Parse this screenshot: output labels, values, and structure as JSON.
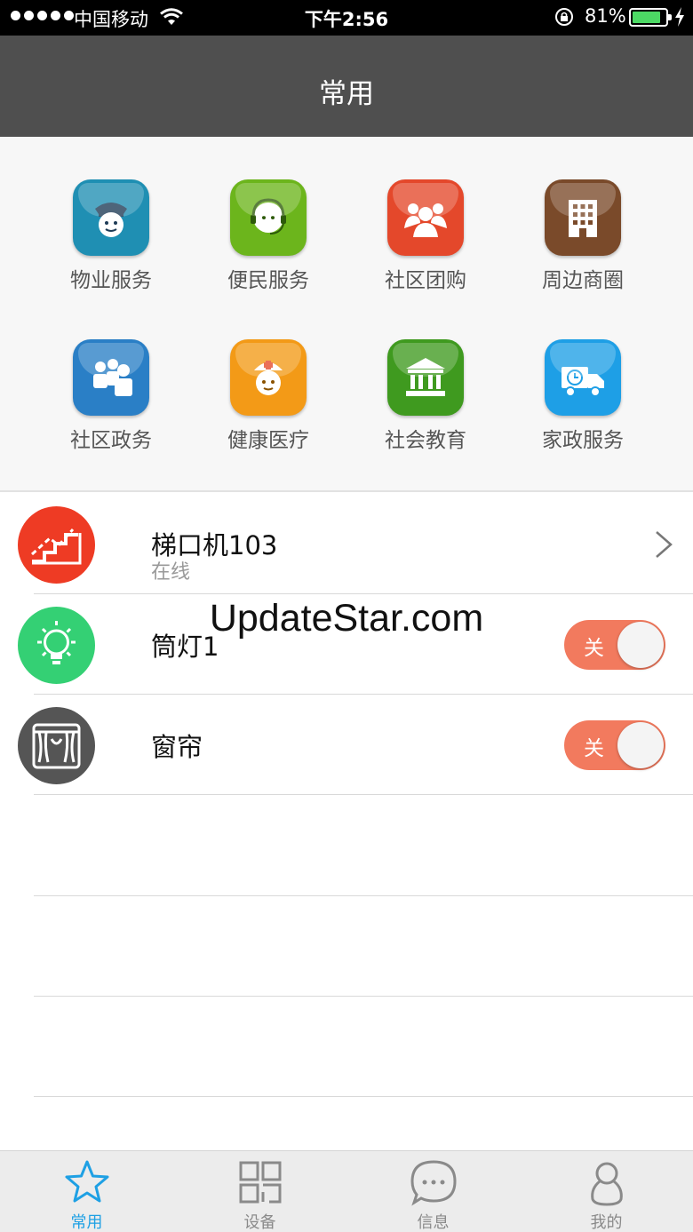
{
  "status_bar": {
    "carrier": "中国移动",
    "time": "下午2:56",
    "battery": "81%",
    "battery_level": 0.81
  },
  "nav": {
    "title": "常用"
  },
  "services": [
    {
      "label": "物业服务",
      "icon": "security-guard-icon",
      "color": "#1f8fb3"
    },
    {
      "label": "便民服务",
      "icon": "customer-service-icon",
      "color": "#6cb51c"
    },
    {
      "label": "社区团购",
      "icon": "group-people-icon",
      "color": "#e4482b"
    },
    {
      "label": "周边商圈",
      "icon": "building-icon",
      "color": "#7a4a2a"
    },
    {
      "label": "社区政务",
      "icon": "users-icon",
      "color": "#2a7fc6"
    },
    {
      "label": "健康医疗",
      "icon": "nurse-icon",
      "color": "#f39a17"
    },
    {
      "label": "社会教育",
      "icon": "institution-icon",
      "color": "#3f9a1f"
    },
    {
      "label": "家政服务",
      "icon": "moving-truck-icon",
      "color": "#1e9fe6"
    }
  ],
  "devices": [
    {
      "name": "梯口机103",
      "status": "在线",
      "icon": "stairs-icon",
      "color": "#ee3b24"
    },
    {
      "name": "筒灯1",
      "toggle": "关",
      "icon": "light-bulb-icon",
      "color": "#34d074"
    },
    {
      "name": "窗帘",
      "toggle": "关",
      "icon": "curtain-icon",
      "color": "#555555"
    }
  ],
  "watermark": "UpdateStar.com",
  "tabs": [
    {
      "label": "常用",
      "icon": "star-icon",
      "active": true
    },
    {
      "label": "设备",
      "icon": "grid-icon",
      "active": false
    },
    {
      "label": "信息",
      "icon": "chat-bubble-icon",
      "active": false
    },
    {
      "label": "我的",
      "icon": "person-icon",
      "active": false
    }
  ]
}
